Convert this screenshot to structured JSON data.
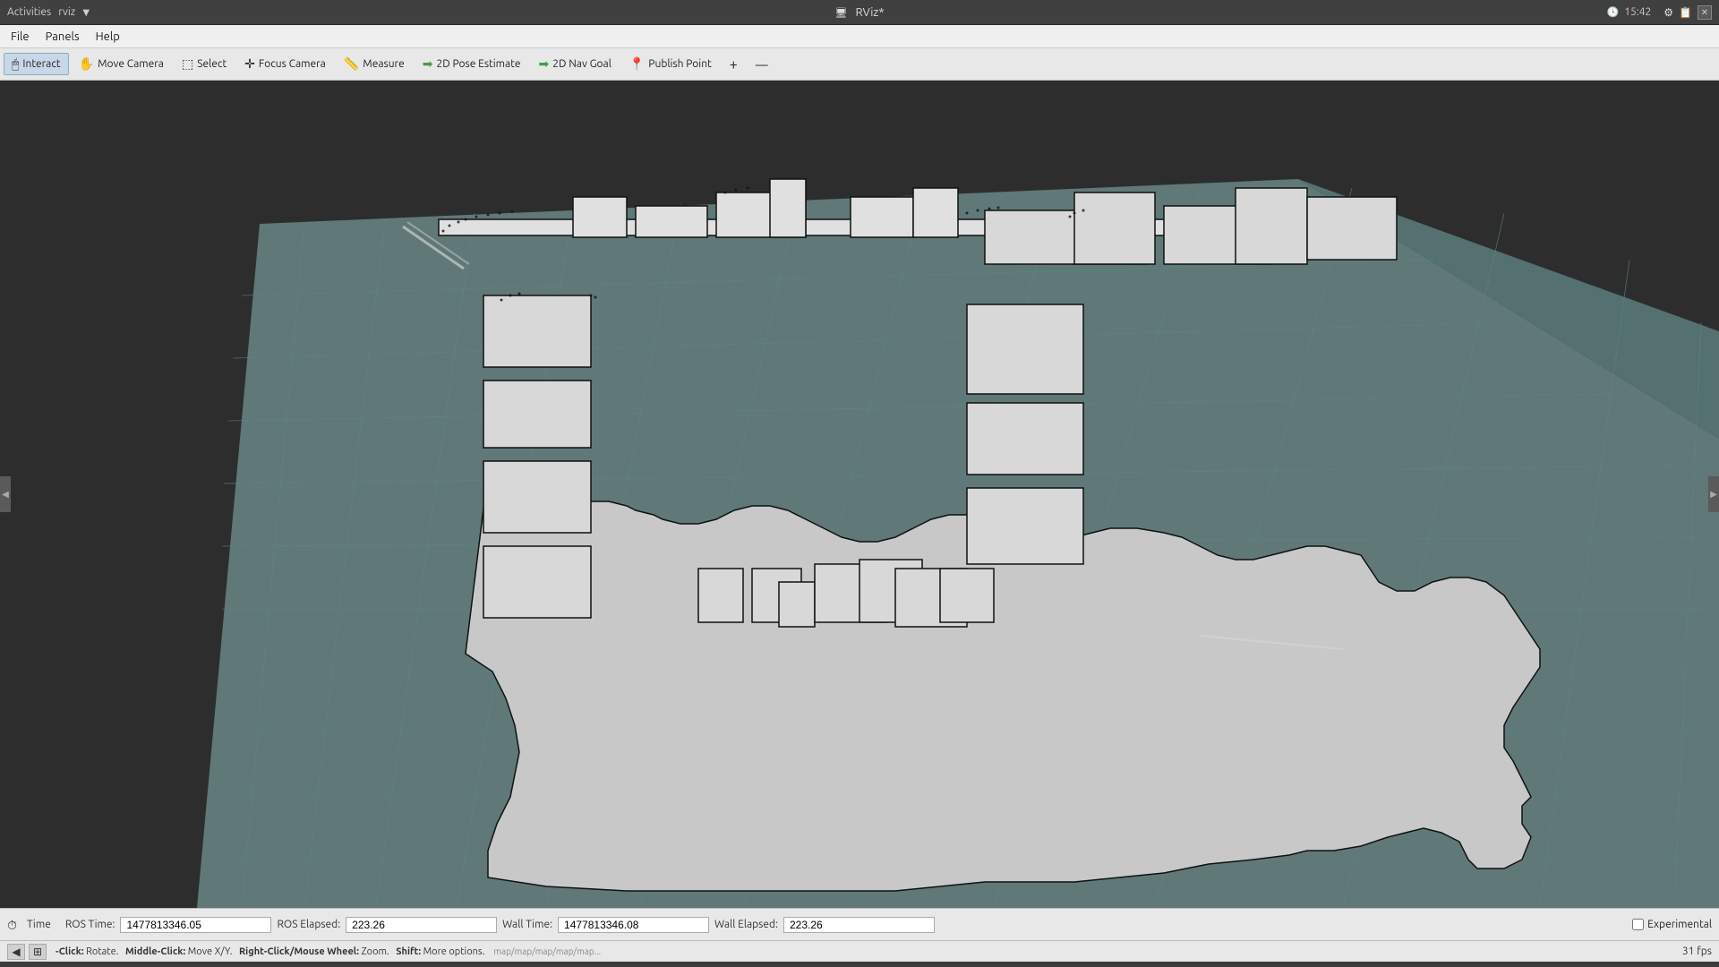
{
  "titlebar": {
    "left_text": "Activities",
    "app_name": "rviz",
    "time": "15:42",
    "title": "RViz*",
    "close_label": "✕"
  },
  "menubar": {
    "items": [
      "File",
      "Panels",
      "Help"
    ]
  },
  "toolbar": {
    "buttons": [
      {
        "id": "interact",
        "label": "Interact",
        "icon": "🖱",
        "active": true
      },
      {
        "id": "move-camera",
        "label": "Move Camera",
        "icon": "✋",
        "active": false
      },
      {
        "id": "select",
        "label": "Select",
        "icon": "⬚",
        "active": false
      },
      {
        "id": "focus-camera",
        "label": "Focus Camera",
        "icon": "✛",
        "active": false
      },
      {
        "id": "measure",
        "label": "Measure",
        "icon": "📏",
        "active": false
      },
      {
        "id": "2d-pose",
        "label": "2D Pose Estimate",
        "icon": "➡",
        "active": false
      },
      {
        "id": "2d-nav",
        "label": "2D Nav Goal",
        "icon": "➡",
        "active": false
      },
      {
        "id": "publish-point",
        "label": "Publish Point",
        "icon": "📍",
        "active": false
      }
    ],
    "add_icon": "+",
    "config_icon": "⚙"
  },
  "statusbar": {
    "time_icon": "⏱",
    "time_label": "Time",
    "ros_time_label": "ROS Time:",
    "ros_time_value": "1477813346.05",
    "ros_elapsed_label": "ROS Elapsed:",
    "ros_elapsed_value": "223.26",
    "wall_time_label": "Wall Time:",
    "wall_time_value": "1477813346.08",
    "wall_elapsed_label": "Wall Elapsed:",
    "wall_elapsed_value": "223.26",
    "experimental_label": "Experimental"
  },
  "hintbar": {
    "hint_text": "-Click: Rotate.  Middle-Click: Move X/Y.  Right-Click/Mouse Wheel: Zoom.  Shift: More options.",
    "fps": "31 fps",
    "url": "map/map/map/map/map..."
  },
  "colors": {
    "background_dark": "#2d2d2d",
    "floor_teal": "#6b9090",
    "map_light": "#d8d8d8",
    "grid_line": "#7a9a9a"
  }
}
